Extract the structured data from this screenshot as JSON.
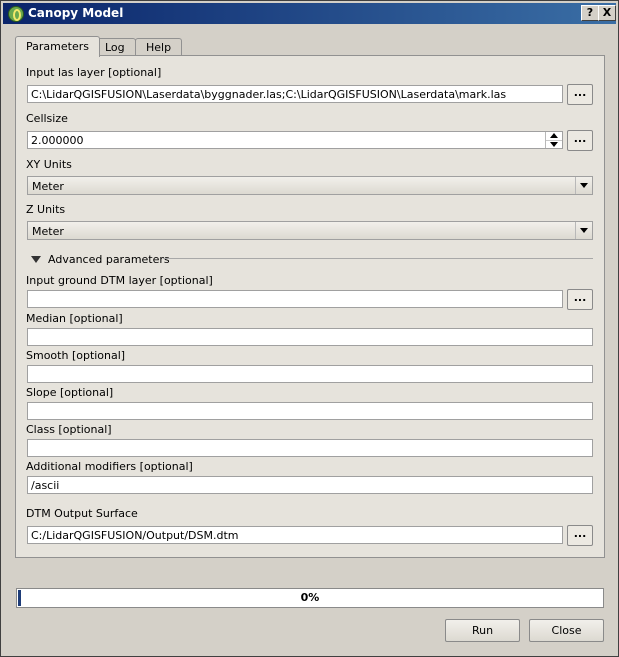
{
  "window": {
    "title": "Canopy Model",
    "help_button": "?",
    "close_button": "X"
  },
  "tabs": [
    {
      "label": "Parameters",
      "active": true
    },
    {
      "label": "Log",
      "active": false
    },
    {
      "label": "Help",
      "active": false
    }
  ],
  "params": {
    "input_las": {
      "label": "Input las layer [optional]",
      "value": "C:\\LidarQGISFUSION\\Laserdata\\byggnader.las;C:\\LidarQGISFUSION\\Laserdata\\mark.las",
      "browse": "..."
    },
    "cellsize": {
      "label": "Cellsize",
      "value": "2.000000",
      "browse": "..."
    },
    "xy_units": {
      "label": "XY Units",
      "value": "Meter"
    },
    "z_units": {
      "label": "Z Units",
      "value": "Meter"
    },
    "advanced_label": "Advanced parameters",
    "ground_dtm": {
      "label": "Input ground DTM layer [optional]",
      "value": "",
      "browse": "..."
    },
    "median": {
      "label": "Median [optional]",
      "value": ""
    },
    "smooth": {
      "label": "Smooth [optional]",
      "value": ""
    },
    "slope": {
      "label": "Slope [optional]",
      "value": ""
    },
    "class": {
      "label": "Class [optional]",
      "value": ""
    },
    "modifiers": {
      "label": "Additional modifiers [optional]",
      "value": "/ascii"
    },
    "output": {
      "label": "DTM Output Surface",
      "value": "C:/LidarQGISFUSION/Output/DSM.dtm",
      "browse": "..."
    }
  },
  "progress": {
    "value": 0,
    "text": "0%"
  },
  "buttons": {
    "run": "Run",
    "close": "Close"
  },
  "colors": {
    "titlebar": "#0a246a",
    "progress_fill": "#1e3c78",
    "window_bg": "#d4d0c8"
  }
}
